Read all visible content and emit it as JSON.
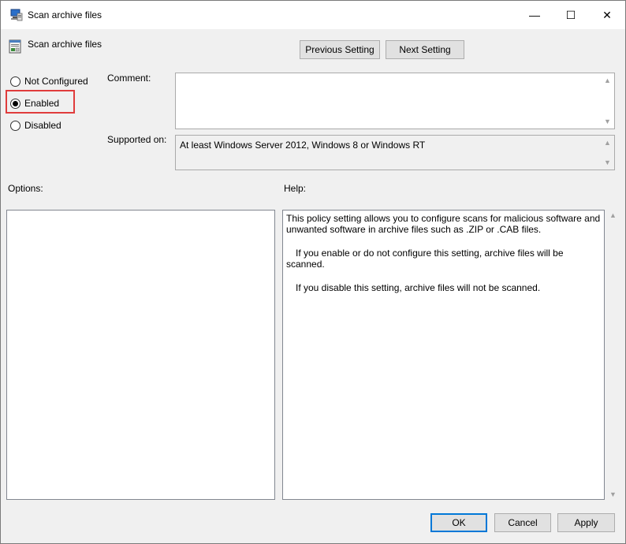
{
  "window": {
    "title": "Scan archive files",
    "controls": {
      "minimize": "—",
      "maximize": "☐",
      "close": "✕"
    }
  },
  "header": {
    "policy_name": "Scan archive files",
    "previous_button": "Previous Setting",
    "next_button": "Next Setting"
  },
  "state": {
    "options": [
      {
        "label": "Not Configured",
        "selected": false
      },
      {
        "label": "Enabled",
        "selected": true
      },
      {
        "label": "Disabled",
        "selected": false
      }
    ]
  },
  "comment": {
    "label": "Comment:",
    "value": ""
  },
  "supported": {
    "label": "Supported on:",
    "value": "At least Windows Server 2012, Windows 8 or Windows RT"
  },
  "options_panel": {
    "label": "Options:"
  },
  "help_panel": {
    "label": "Help:",
    "paragraphs": [
      "This policy setting allows you to configure scans for malicious software and unwanted software in archive files such as .ZIP or .CAB files.",
      "If you enable or do not configure this setting, archive files will be scanned.",
      "If you disable this setting, archive files will not be scanned."
    ]
  },
  "footer": {
    "ok": "OK",
    "cancel": "Cancel",
    "apply": "Apply"
  },
  "colors": {
    "highlight": "#e03c3c",
    "default_button_border": "#0078d7",
    "dialog_bg": "#f0f0f0"
  },
  "icons": {
    "title": "group-policy-computer-icon",
    "header": "policy-setting-icon"
  }
}
